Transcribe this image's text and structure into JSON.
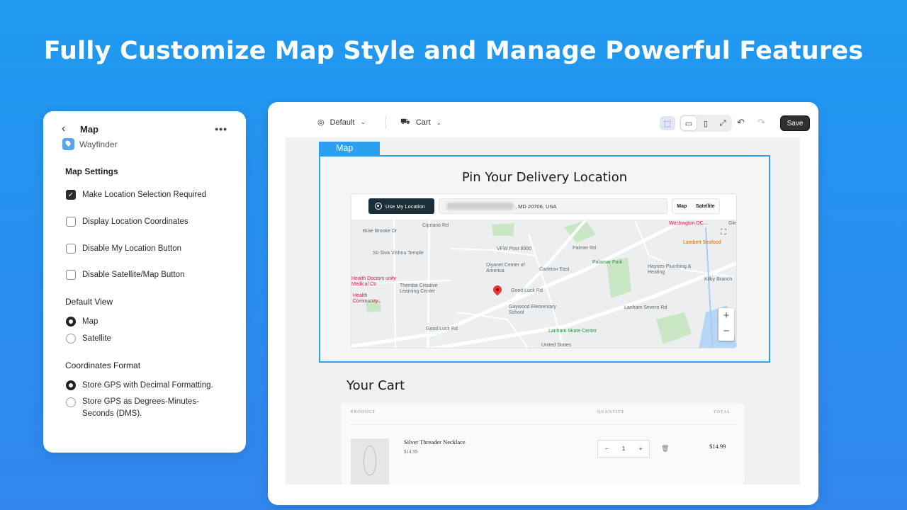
{
  "headline": "Fully Customize Map Style and Manage Powerful Features",
  "panel": {
    "title": "Map",
    "more": "•••",
    "app_name": "Wayfinder",
    "section_map_settings": "Map Settings",
    "checkboxes": [
      {
        "label": "Make Location Selection Required",
        "checked": true
      },
      {
        "label": "Display Location Coordinates",
        "checked": false
      },
      {
        "label": "Disable My Location Button",
        "checked": false
      },
      {
        "label": "Disable Satellite/Map Button",
        "checked": false
      }
    ],
    "default_view_label": "Default View",
    "default_view_options": [
      {
        "label": "Map",
        "selected": true
      },
      {
        "label": "Satellite",
        "selected": false
      }
    ],
    "coords_format_label": "Coordinates Format",
    "coords_format_options": [
      {
        "label": "Store GPS with Decimal Formatting.",
        "selected": true
      },
      {
        "label": "Store GPS as Degrees-Minutes-Seconds (DMS).",
        "selected": false
      }
    ]
  },
  "editor": {
    "theme_select": "Default",
    "page_select": "Cart",
    "save_label": "Save",
    "map_tag": "Map",
    "map_title": "Pin Your Delivery Location",
    "use_my_location": "Use My Location",
    "address_suffix": ", MD 20706, USA",
    "map_type": [
      "Map",
      "Satellite"
    ],
    "map_labels": [
      "Brae Brooke Dr",
      "Cipriano Rd",
      "Sri Siva Vishnu Temple",
      "VFW Post 8950",
      "Palmer Rd",
      "Diyanet Center of America",
      "Carleton East",
      "Palamar Park",
      "Haynes Plumbing & Heating",
      "Washington DC...",
      "Lambert Seafood",
      "Health Doctors unity Medical Ctr",
      "Themba Creative Learning Center",
      "Health Community...",
      "Good Luck Rd",
      "Gaywood Elementary School",
      "Lanham Skate Center",
      "United States",
      "Lanham Severn Rd",
      "Kilby Branch",
      "Good Luck Rd",
      "Glenn Dale"
    ],
    "cart_title": "Your Cart",
    "cart_headers": {
      "product": "PRODUCT",
      "quantity": "QUANTITY",
      "total": "TOTAL"
    },
    "product_name": "Silver Threader Necklace",
    "product_price": "$14.99",
    "quantity": "1",
    "line_total": "$14.99"
  }
}
